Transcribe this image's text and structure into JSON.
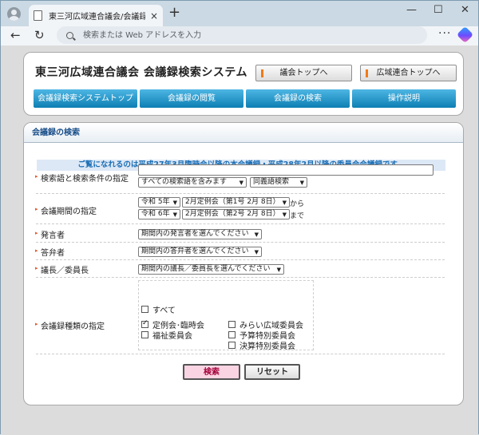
{
  "browser": {
    "tab_title": "東三河広域連合議会/会議録検索",
    "tab_close": "×",
    "new_tab": "+",
    "omnibox_placeholder": "検索または Web アドレスを入力",
    "more": "···",
    "win_min": "—",
    "win_max": "☐",
    "win_close": "✕",
    "back": "←",
    "refresh": "↻"
  },
  "header": {
    "site_title": "東三河広域連合議会 会議録検索システム",
    "top_links": [
      "議会トップへ",
      "広域連合トップへ"
    ],
    "menu": [
      "会議録検索システムトップ",
      "会議録の閲覧",
      "会議録の検索",
      "操作説明"
    ]
  },
  "section": {
    "title": "会議録の検索",
    "notice": "ご覧になれるのは平成27年3月臨時会以降の本会議録・平成28年2月以降の委員会会議録です。"
  },
  "form": {
    "keyword_label": "検索語と検索条件の指定",
    "keyword_value": "",
    "match_select": "すべての検索語を含みます",
    "synonym_select": "同義語検索",
    "period_label": "会議期間の指定",
    "from_year": "令和 5年",
    "from_session": "2月定例会（第1号 2月 8日）",
    "from_suffix": "から",
    "to_year": "令和 6年",
    "to_session": "2月定例会（第2号 2月 8日）",
    "to_suffix": "まで",
    "speaker_label": "発言者",
    "speaker_select": "期間内の発言者を選んでください",
    "answerer_label": "答弁者",
    "answerer_select": "期間内の答弁者を選んでください",
    "chair_label": "議長／委員長",
    "chair_select": "期間内の議長／委員長を選んでください",
    "type_label": "会議録種類の指定",
    "all_label": "すべて",
    "types_left": [
      {
        "label": "定例会･臨時会",
        "checked": true
      },
      {
        "label": "福祉委員会",
        "checked": false
      }
    ],
    "types_right": [
      {
        "label": "みらい広域委員会",
        "checked": false
      },
      {
        "label": "予算特別委員会",
        "checked": false
      },
      {
        "label": "決算特別委員会",
        "checked": false
      }
    ],
    "search_button": "検索",
    "reset_button": "リセット"
  },
  "colors": {
    "menu_top": "#4db6e4",
    "menu_bottom": "#0d7fb3",
    "notice_text": "#1a6eb5",
    "section_title": "#1a4f8a",
    "search_button_bg": "#fbd4e3"
  }
}
